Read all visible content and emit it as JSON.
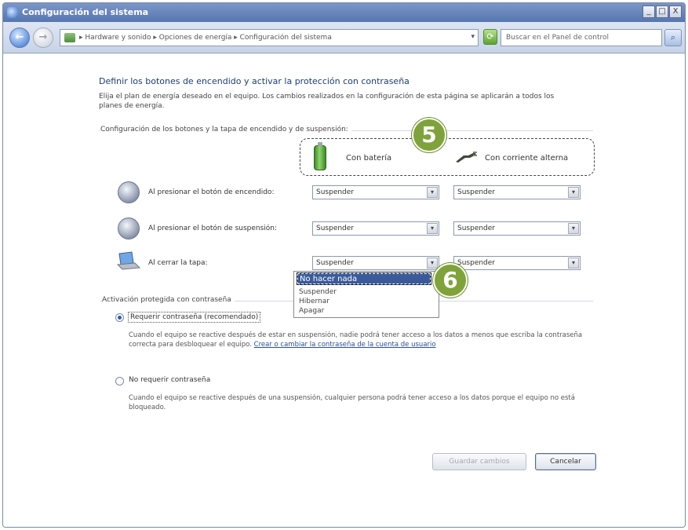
{
  "window": {
    "title": "Configuración del sistema",
    "controls": [
      "_",
      "□",
      "X"
    ]
  },
  "address_bar": {
    "crumbs": "▸ Hardware y sonido ▸ Opciones de energía ▸ Configuración del sistema",
    "search_placeholder": "Buscar en el Panel de control"
  },
  "main": {
    "heading": "Definir los botones de encendido y activar la protección con contraseña",
    "intro": "Elija el plan de energía deseado en el equipo. Los cambios realizados en la configuración de esta página se aplicarán a todos los planes de energía.",
    "group_label": "Configuración de los botones y la tapa de encendido y de suspensión:",
    "columns": {
      "battery": "Con batería",
      "plugged": "Con corriente alterna"
    },
    "rows": [
      {
        "label": "Al presionar el botón de encendido:",
        "battery": "Suspender",
        "plugged": "Suspender"
      },
      {
        "label": "Al presionar el botón de suspensión:",
        "battery": "Suspender",
        "plugged": "Suspender"
      },
      {
        "label": "Al cerrar la tapa:",
        "battery": "Suspender",
        "plugged": "Suspender"
      }
    ],
    "dropdown_options": [
      "No hacer nada",
      "Suspender",
      "Hibernar",
      "Apagar"
    ],
    "password_group_label": "Activación protegida con contraseña",
    "require_password": {
      "label": "Requerir contraseña (recomendado)",
      "desc": "Cuando el equipo se reactive después de estar en suspensión, nadie podrá tener acceso a los datos a menos que escriba la contraseña correcta para desbloquear el equipo.",
      "link": "Crear o cambiar la contraseña de la cuenta de usuario"
    },
    "no_password": {
      "label": "No requerir contraseña",
      "desc": "Cuando el equipo se reactive después de una suspensión, cualquier persona podrá tener acceso a los datos porque el equipo no está bloqueado."
    },
    "buttons": {
      "save": "Guardar cambios",
      "cancel": "Cancelar"
    },
    "callouts": {
      "five": "5",
      "six": "6"
    }
  }
}
